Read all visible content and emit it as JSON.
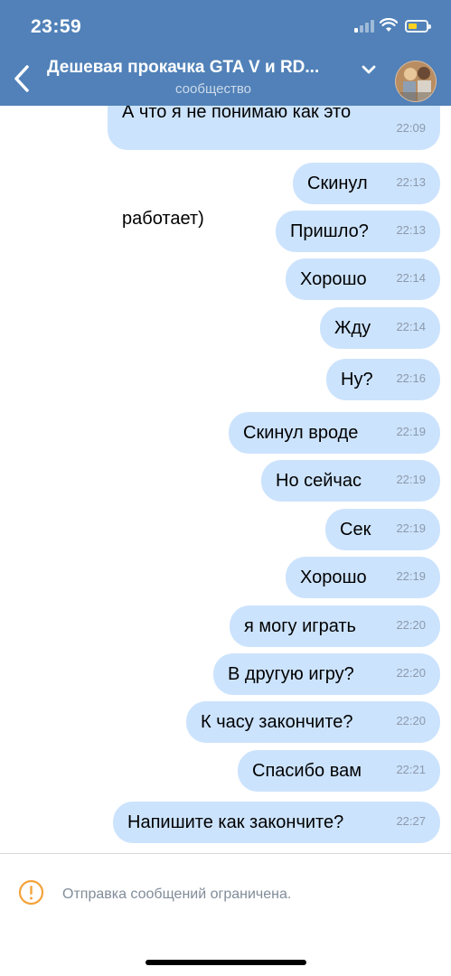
{
  "status_bar": {
    "time": "23:59"
  },
  "header": {
    "title": "Дешевая прокачка GTA V и RD...",
    "subtitle": "сообщество",
    "accent_color": "#5181b8",
    "icons": [
      "back-arrow-icon",
      "chevron-down-icon",
      "community-avatar"
    ]
  },
  "messages": [
    {
      "text": "А что я не понимаю как это",
      "time": ""
    },
    {
      "text": "работает)",
      "time": "22:09"
    },
    {
      "text": "Скинул",
      "time": "22:13"
    },
    {
      "text": "Пришло?",
      "time": "22:13"
    },
    {
      "text": "Хорошо",
      "time": "22:14"
    },
    {
      "text": "Жду",
      "time": "22:14"
    },
    {
      "text": "Ну?",
      "time": "22:16"
    },
    {
      "text": "Скинул вроде",
      "time": "22:19"
    },
    {
      "text": "Но сейчас",
      "time": "22:19"
    },
    {
      "text": "Сек",
      "time": "22:19"
    },
    {
      "text": "Хорошо",
      "time": "22:19"
    },
    {
      "text": "я могу играть",
      "time": "22:20"
    },
    {
      "text": "В другую игру?",
      "time": "22:20"
    },
    {
      "text": "К часу закончите?",
      "time": "22:20"
    },
    {
      "text": "Спасибо вам",
      "time": "22:21"
    },
    {
      "text": "Напишите как закончите?",
      "time": "22:27"
    }
  ],
  "footer": {
    "notice": "Отправка сообщений ограничена.",
    "icon": "warning-circle-icon",
    "warning_color": "#f4a33c"
  },
  "colors": {
    "bubble": "#cce3fd",
    "timestamp": "#8c9aab"
  }
}
